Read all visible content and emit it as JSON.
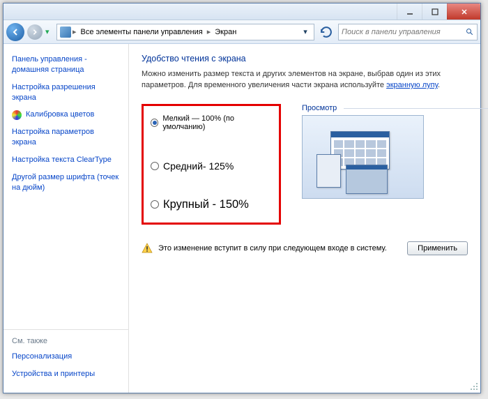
{
  "titlebar": {
    "tooltip_min": "",
    "tooltip_max": "",
    "tooltip_close": ""
  },
  "nav": {
    "breadcrumb": {
      "root": "Все элементы панели управления",
      "current": "Экран"
    },
    "search_placeholder": "Поиск в панели управления"
  },
  "sidebar": {
    "links": [
      "Панель управления - домашняя страница",
      "Настройка разрешения экрана",
      "Калибровка цветов",
      "Настройка параметров экрана",
      "Настройка текста ClearType",
      "Другой размер шрифта (точек на дюйм)"
    ],
    "see_also_heading": "См. также",
    "see_also": [
      "Персонализация",
      "Устройства и принтеры"
    ]
  },
  "main": {
    "heading": "Удобство чтения с экрана",
    "desc_1": "Можно изменить размер текста и других элементов на экране, выбрав один из этих параметров. Для временного увеличения части экрана используйте ",
    "desc_link": "экранную лупу",
    "desc_2": ".",
    "options": [
      {
        "label": "Мелкий — 100% (по умолчанию)",
        "checked": true
      },
      {
        "label": "Средний- 125%",
        "checked": false
      },
      {
        "label": "Крупный - 150%",
        "checked": false
      }
    ],
    "preview_label": "Просмотр",
    "warning": "Это изменение вступит в силу при следующем входе в систему.",
    "apply": "Применить"
  }
}
